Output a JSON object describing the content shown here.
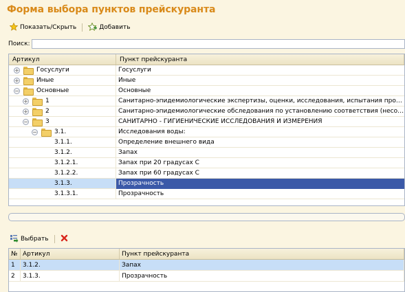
{
  "window": {
    "title": "Форма выбора пунктов прейскуранта"
  },
  "toolbar": {
    "show_hide_label": "Показать/Скрыть",
    "add_label": "Добавить"
  },
  "search": {
    "label": "Поиск:",
    "value": ""
  },
  "tree": {
    "columns": [
      "Артикул",
      "Пункт прейскуранта"
    ],
    "rows": [
      {
        "article": "Госуслуги",
        "item": "Госуслуги",
        "level": 0,
        "expander": "+",
        "folder": true,
        "selected": false
      },
      {
        "article": "Иные",
        "item": "Иные",
        "level": 0,
        "expander": "+",
        "folder": true,
        "selected": false
      },
      {
        "article": "Основные",
        "item": "Основные",
        "level": 0,
        "expander": "−",
        "folder": true,
        "selected": false
      },
      {
        "article": "1",
        "item": "Санитарно-эпидемиологические экспертизы, оценки, исследования, испытания проектной и...",
        "level": 1,
        "expander": "+",
        "folder": true,
        "selected": false
      },
      {
        "article": "2",
        "item": "Санитарно-эпидемиологические обследования по установлению соответствия (несоответстви...",
        "level": 1,
        "expander": "+",
        "folder": true,
        "selected": false
      },
      {
        "article": "3",
        "item": "САНИТАРНО - ГИГИЕНИЧЕСКИЕ ИССЛЕДОВАНИЯ И ИЗМЕРЕНИЯ",
        "level": 1,
        "expander": "−",
        "folder": true,
        "selected": false
      },
      {
        "article": "3.1.",
        "item": "Исследования воды:",
        "level": 2,
        "expander": "−",
        "folder": true,
        "selected": false
      },
      {
        "article": "3.1.1.",
        "item": "Определение внешнего вида",
        "level": 3,
        "expander": "",
        "folder": false,
        "selected": false
      },
      {
        "article": "3.1.2.",
        "item": "Запах",
        "level": 3,
        "expander": "",
        "folder": false,
        "selected": false
      },
      {
        "article": "3.1.2.1.",
        "item": "Запах при 20 градусах С",
        "level": 3,
        "expander": "",
        "folder": false,
        "selected": false
      },
      {
        "article": "3.1.2.2.",
        "item": "Запах при 60 градусах С",
        "level": 3,
        "expander": "",
        "folder": false,
        "selected": false
      },
      {
        "article": "3.1.3.",
        "item": "Прозрачность",
        "level": 3,
        "expander": "",
        "folder": false,
        "selected": true
      },
      {
        "article": "3.1.3.1.",
        "item": "Прозрачность",
        "level": 3,
        "expander": "",
        "folder": false,
        "selected": false
      }
    ]
  },
  "toolbar2": {
    "select_label": "Выбрать"
  },
  "selected_list": {
    "columns": [
      "№",
      "Артикул",
      "Пункт прейскуранта"
    ],
    "rows": [
      {
        "num": "1",
        "article": "3.1.2.",
        "item": "Запах",
        "selected": true
      },
      {
        "num": "2",
        "article": "3.1.3.",
        "item": "Прозрачность",
        "selected": false
      }
    ]
  },
  "colors": {
    "title": "#d98a1a",
    "selection": "#3b59a8",
    "row_highlight": "#c7def7",
    "background": "#fbf5e1"
  }
}
